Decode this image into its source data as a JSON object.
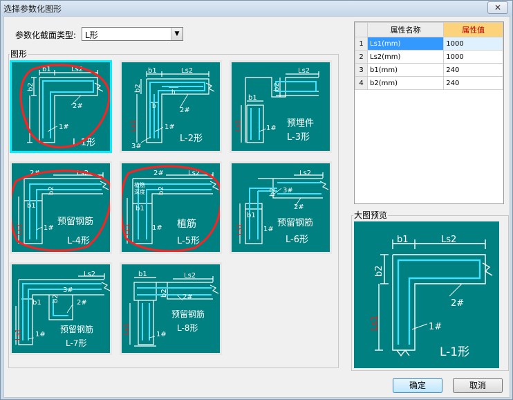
{
  "window": {
    "title": "选择参数化图形",
    "close_label": "✕"
  },
  "section_type": {
    "label": "参数化截面类型:",
    "selected": "L形"
  },
  "section_graphics": {
    "label": "图形"
  },
  "thumbnails": [
    {
      "caption": "L-1形",
      "labels": [
        "b1",
        "Ls2",
        "b2",
        "2#",
        "Ls1",
        "1#"
      ]
    },
    {
      "caption": "L-2形",
      "labels": [
        "b1",
        "Ls2",
        "b2",
        "h",
        "b",
        "2#",
        "Ls1",
        "1#",
        "3#"
      ]
    },
    {
      "caption_lines": [
        "预埋件",
        "L-3形"
      ],
      "labels": [
        "Ls2",
        "b2",
        "b1",
        "Ls1",
        "1#"
      ]
    },
    {
      "caption_lines": [
        "预留钢筋",
        "L-4形"
      ],
      "labels": [
        "2#",
        "Ls2",
        "b2",
        "b1",
        "Ls1",
        "1#"
      ]
    },
    {
      "caption_lines": [
        "植筋",
        "L-5形"
      ],
      "labels": [
        "2#",
        "Ls2",
        "植筋",
        "深度",
        "b2",
        "b1",
        "Ls1",
        "1#"
      ]
    },
    {
      "caption_lines": [
        "预留钢筋",
        "L-6形"
      ],
      "labels": [
        "Ls2",
        "b2",
        "3#",
        "2#",
        "b1",
        "Ls1",
        "1#"
      ]
    },
    {
      "caption_lines": [
        "预留钢筋",
        "L-7形"
      ],
      "labels": [
        "Ls2",
        "b1",
        "b2",
        "3#",
        "2#",
        "Ls1",
        "1#"
      ]
    },
    {
      "caption_lines": [
        "预留钢筋",
        "L-8形"
      ],
      "labels": [
        "b1",
        "Ls2",
        "b2",
        "2#",
        "Ls1",
        "1#"
      ]
    }
  ],
  "property_table": {
    "headers": [
      "属性名称",
      "属性值"
    ],
    "rows": [
      {
        "index": "1",
        "name": "Ls1(mm)",
        "value": "1000"
      },
      {
        "index": "2",
        "name": "Ls2(mm)",
        "value": "1000"
      },
      {
        "index": "3",
        "name": "b1(mm)",
        "value": "240"
      },
      {
        "index": "4",
        "name": "b2(mm)",
        "value": "240"
      }
    ]
  },
  "preview": {
    "label": "大图预览",
    "caption": "L-1形",
    "labels": [
      "b1",
      "Ls2",
      "b2",
      "2#",
      "Ls1",
      "1#"
    ]
  },
  "buttons": {
    "ok": "确定",
    "cancel": "取消"
  },
  "colors": {
    "drawing_bg": "#008080",
    "line": "#ffffff",
    "rebar": "#40e0ff",
    "dim_red": "#e02020",
    "highlight_border": "#00f0ff",
    "annotation_red": "#ff2020"
  }
}
